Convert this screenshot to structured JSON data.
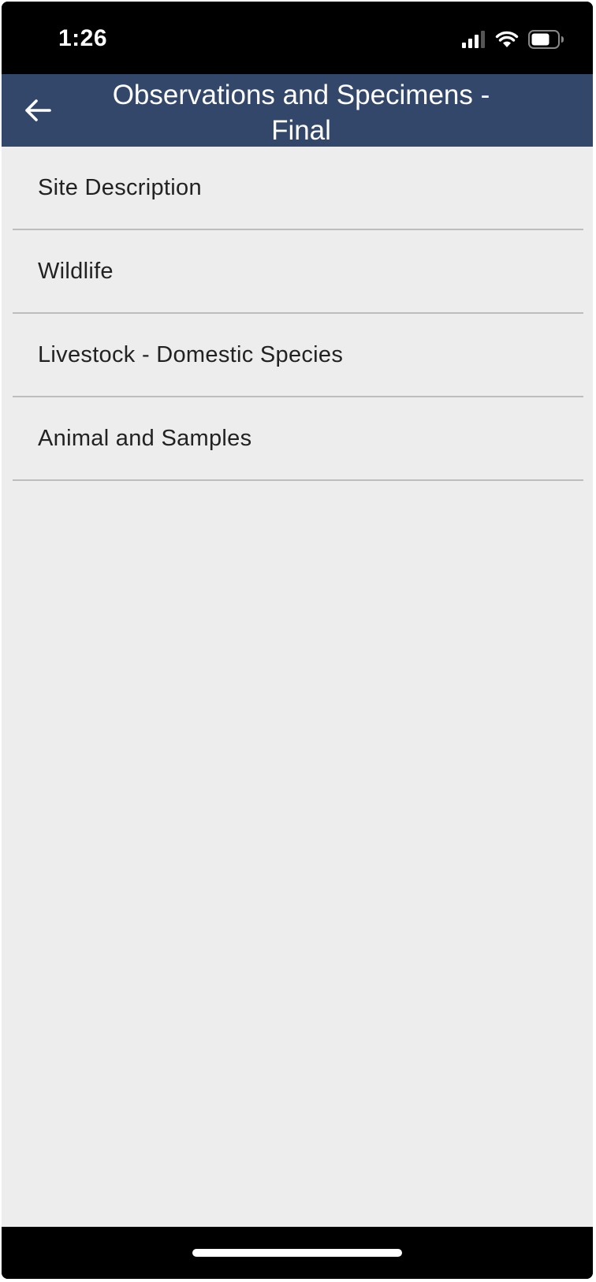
{
  "status_bar": {
    "time": "1:26",
    "icons": [
      "cellular-signal-icon",
      "wifi-icon",
      "battery-icon"
    ]
  },
  "header": {
    "title": "Observations and Specimens - Final",
    "back_icon": "back-arrow-icon",
    "background_color": "#33476a"
  },
  "menu": {
    "items": [
      {
        "label": "Site Description"
      },
      {
        "label": "Wildlife"
      },
      {
        "label": "Livestock - Domestic Species"
      },
      {
        "label": "Animal and Samples"
      }
    ]
  }
}
